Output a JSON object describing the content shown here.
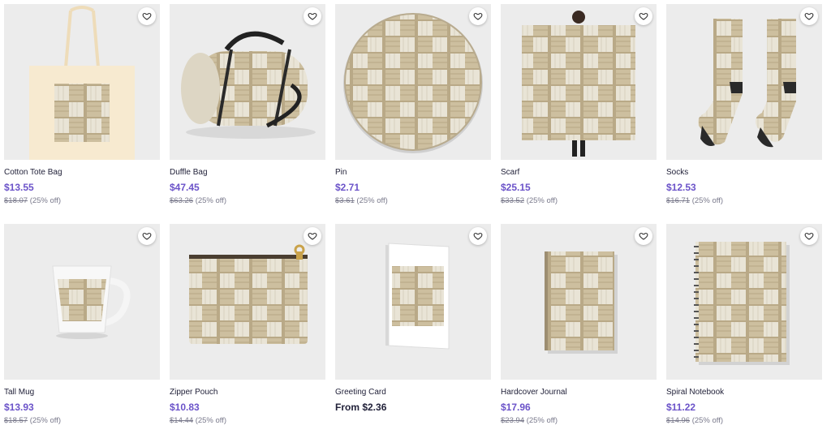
{
  "colors": {
    "price_accent": "#6b53c9",
    "text_dark": "#22223a",
    "text_muted": "#7a7a8c",
    "thumb_bg": "#efefef",
    "weave_light": "#e9e4d6",
    "weave_dark": "#b9a987"
  },
  "favorite_icon": "heart-outline-icon",
  "products": [
    {
      "name": "Cotton Tote Bag",
      "price": "$13.55",
      "old_price": "$18.07",
      "discount": "(25% off)"
    },
    {
      "name": "Duffle Bag",
      "price": "$47.45",
      "old_price": "$63.26",
      "discount": "(25% off)"
    },
    {
      "name": "Pin",
      "price": "$2.71",
      "old_price": "$3.61",
      "discount": "(25% off)"
    },
    {
      "name": "Scarf",
      "price": "$25.15",
      "old_price": "$33.52",
      "discount": "(25% off)"
    },
    {
      "name": "Socks",
      "price": "$12.53",
      "old_price": "$16.71",
      "discount": "(25% off)"
    },
    {
      "name": "Tall Mug",
      "price": "$13.93",
      "old_price": "$18.57",
      "discount": "(25% off)"
    },
    {
      "name": "Zipper Pouch",
      "price": "$10.83",
      "old_price": "$14.44",
      "discount": "(25% off)"
    },
    {
      "name": "Greeting Card",
      "price": "From $2.36",
      "old_price": "",
      "discount": ""
    },
    {
      "name": "Hardcover Journal",
      "price": "$17.96",
      "old_price": "$23.94",
      "discount": "(25% off)"
    },
    {
      "name": "Spiral Notebook",
      "price": "$11.22",
      "old_price": "$14.96",
      "discount": "(25% off)"
    }
  ]
}
